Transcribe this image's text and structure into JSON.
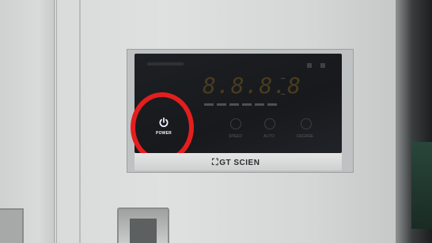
{
  "device": {
    "brand": "GT SCIEN",
    "display_value": "8.8.8.8",
    "power_button_label": "POWER",
    "buttons": [
      {
        "label": "SPEED",
        "icon": "fan-icon"
      },
      {
        "label": "AUTO",
        "icon": "refresh-icon"
      },
      {
        "label": "DEGREE",
        "icon": "power-icon"
      }
    ],
    "power_icon": "power-icon"
  },
  "colors": {
    "highlight_ring": "#e41e1e",
    "panel_glass": "#1b1e22",
    "cabinet": "#dcdede"
  }
}
